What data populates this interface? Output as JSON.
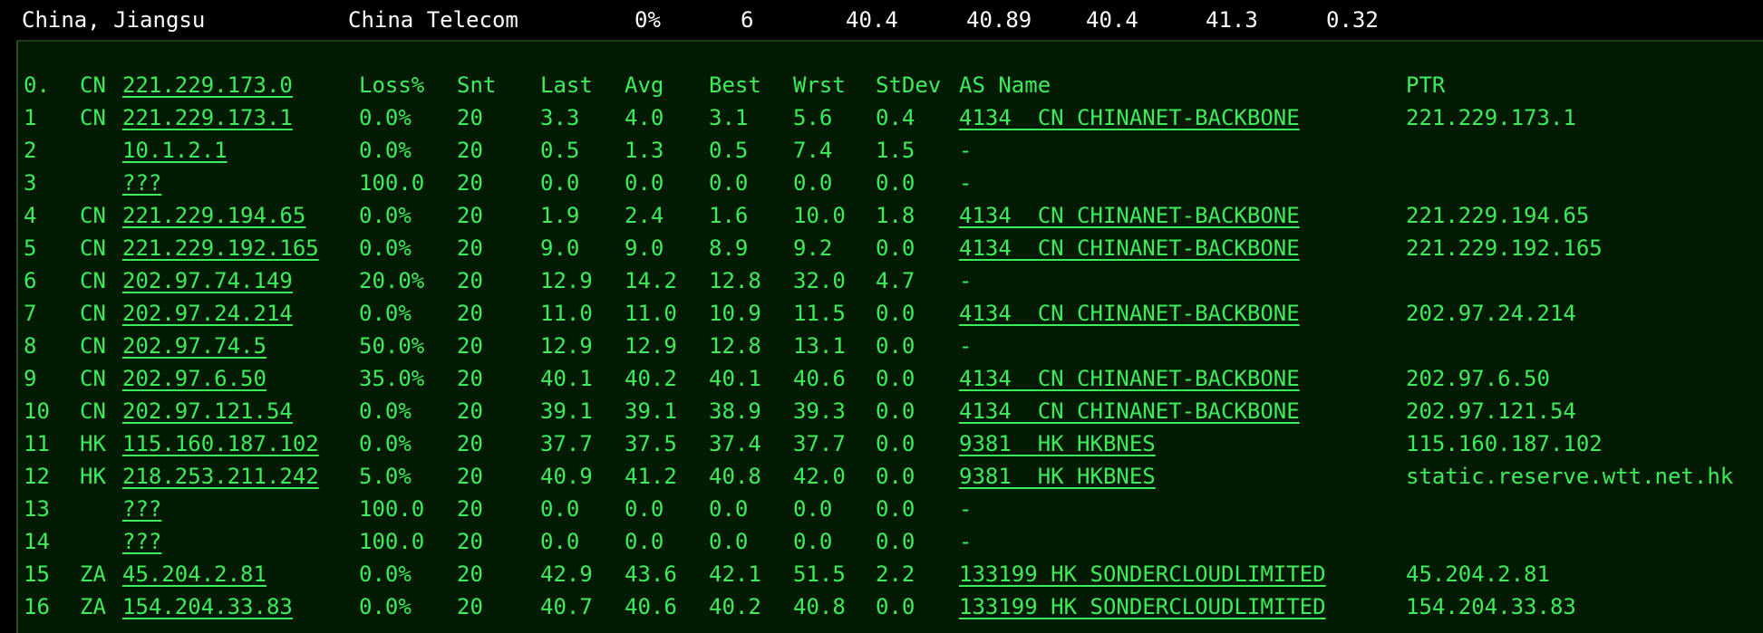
{
  "summary": {
    "location": "China, Jiangsu",
    "isp": "China Telecom",
    "loss": "0%",
    "sent": "6",
    "last": "40.4",
    "avg": "40.89",
    "best": "40.4",
    "worst": "41.3",
    "stdev": "0.32"
  },
  "colors": {
    "text": "#3ded5a",
    "panel_bg": "#031a03",
    "summary_text": "#ffffff",
    "background": "#000000"
  },
  "table": {
    "header": {
      "hop": "0.",
      "cc": "CN",
      "host": "221.229.173.0",
      "loss": "Loss%",
      "snt": "Snt",
      "last": "Last",
      "avg": "Avg",
      "best": "Best",
      "wrst": "Wrst",
      "stdev": "StDev",
      "as": "AS Name",
      "ptr": "PTR"
    },
    "rows": [
      {
        "hop": "1",
        "cc": "CN",
        "host": "221.229.173.1",
        "loss": "0.0%",
        "snt": "20",
        "last": "3.3",
        "avg": "4.0",
        "best": "3.1",
        "wrst": "5.6",
        "stdev": "0.4",
        "as": "4134  CN CHINANET-BACKBONE",
        "ptr": "221.229.173.1"
      },
      {
        "hop": "2",
        "cc": "",
        "host": "10.1.2.1",
        "loss": "0.0%",
        "snt": "20",
        "last": "0.5",
        "avg": "1.3",
        "best": "0.5",
        "wrst": "7.4",
        "stdev": "1.5",
        "as": "-",
        "ptr": ""
      },
      {
        "hop": "3",
        "cc": "",
        "host": "???",
        "loss": "100.0",
        "snt": "20",
        "last": "0.0",
        "avg": "0.0",
        "best": "0.0",
        "wrst": "0.0",
        "stdev": "0.0",
        "as": "-",
        "ptr": ""
      },
      {
        "hop": "4",
        "cc": "CN",
        "host": "221.229.194.65",
        "loss": "0.0%",
        "snt": "20",
        "last": "1.9",
        "avg": "2.4",
        "best": "1.6",
        "wrst": "10.0",
        "stdev": "1.8",
        "as": "4134  CN CHINANET-BACKBONE",
        "ptr": "221.229.194.65"
      },
      {
        "hop": "5",
        "cc": "CN",
        "host": "221.229.192.165",
        "loss": "0.0%",
        "snt": "20",
        "last": "9.0",
        "avg": "9.0",
        "best": "8.9",
        "wrst": "9.2",
        "stdev": "0.0",
        "as": "4134  CN CHINANET-BACKBONE",
        "ptr": "221.229.192.165"
      },
      {
        "hop": "6",
        "cc": "CN",
        "host": "202.97.74.149",
        "loss": "20.0%",
        "snt": "20",
        "last": "12.9",
        "avg": "14.2",
        "best": "12.8",
        "wrst": "32.0",
        "stdev": "4.7",
        "as": "-",
        "ptr": ""
      },
      {
        "hop": "7",
        "cc": "CN",
        "host": "202.97.24.214",
        "loss": "0.0%",
        "snt": "20",
        "last": "11.0",
        "avg": "11.0",
        "best": "10.9",
        "wrst": "11.5",
        "stdev": "0.0",
        "as": "4134  CN CHINANET-BACKBONE",
        "ptr": "202.97.24.214"
      },
      {
        "hop": "8",
        "cc": "CN",
        "host": "202.97.74.5",
        "loss": "50.0%",
        "snt": "20",
        "last": "12.9",
        "avg": "12.9",
        "best": "12.8",
        "wrst": "13.1",
        "stdev": "0.0",
        "as": "-",
        "ptr": ""
      },
      {
        "hop": "9",
        "cc": "CN",
        "host": "202.97.6.50",
        "loss": "35.0%",
        "snt": "20",
        "last": "40.1",
        "avg": "40.2",
        "best": "40.1",
        "wrst": "40.6",
        "stdev": "0.0",
        "as": "4134  CN CHINANET-BACKBONE",
        "ptr": "202.97.6.50"
      },
      {
        "hop": "10",
        "cc": "CN",
        "host": "202.97.121.54",
        "loss": "0.0%",
        "snt": "20",
        "last": "39.1",
        "avg": "39.1",
        "best": "38.9",
        "wrst": "39.3",
        "stdev": "0.0",
        "as": "4134  CN CHINANET-BACKBONE",
        "ptr": "202.97.121.54"
      },
      {
        "hop": "11",
        "cc": "HK",
        "host": "115.160.187.102",
        "loss": "0.0%",
        "snt": "20",
        "last": "37.7",
        "avg": "37.5",
        "best": "37.4",
        "wrst": "37.7",
        "stdev": "0.0",
        "as": "9381  HK HKBNES",
        "ptr": "115.160.187.102"
      },
      {
        "hop": "12",
        "cc": "HK",
        "host": "218.253.211.242",
        "loss": "5.0%",
        "snt": "20",
        "last": "40.9",
        "avg": "41.2",
        "best": "40.8",
        "wrst": "42.0",
        "stdev": "0.0",
        "as": "9381  HK HKBNES",
        "ptr": "static.reserve.wtt.net.hk"
      },
      {
        "hop": "13",
        "cc": "",
        "host": "???",
        "loss": "100.0",
        "snt": "20",
        "last": "0.0",
        "avg": "0.0",
        "best": "0.0",
        "wrst": "0.0",
        "stdev": "0.0",
        "as": "-",
        "ptr": ""
      },
      {
        "hop": "14",
        "cc": "",
        "host": "???",
        "loss": "100.0",
        "snt": "20",
        "last": "0.0",
        "avg": "0.0",
        "best": "0.0",
        "wrst": "0.0",
        "stdev": "0.0",
        "as": "-",
        "ptr": ""
      },
      {
        "hop": "15",
        "cc": "ZA",
        "host": "45.204.2.81",
        "loss": "0.0%",
        "snt": "20",
        "last": "42.9",
        "avg": "43.6",
        "best": "42.1",
        "wrst": "51.5",
        "stdev": "2.2",
        "as": "133199 HK SONDERCLOUDLIMITED",
        "ptr": "45.204.2.81"
      },
      {
        "hop": "16",
        "cc": "ZA",
        "host": "154.204.33.83",
        "loss": "0.0%",
        "snt": "20",
        "last": "40.7",
        "avg": "40.6",
        "best": "40.2",
        "wrst": "40.8",
        "stdev": "0.0",
        "as": "133199 HK SONDERCLOUDLIMITED",
        "ptr": "154.204.33.83"
      }
    ]
  }
}
